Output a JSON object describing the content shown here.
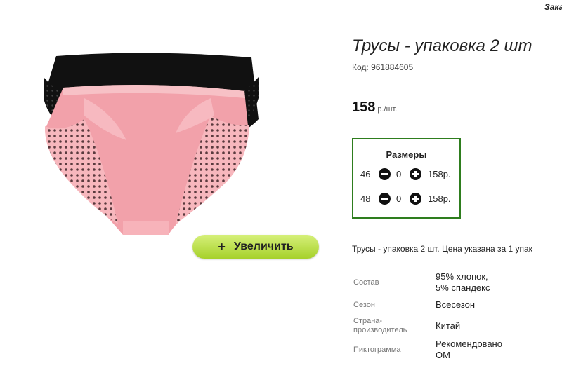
{
  "header": {
    "link_label": "Зака"
  },
  "product": {
    "title": "Трусы - упаковка 2 шт",
    "sku": "Код: 961884605",
    "price": "158",
    "price_unit": "р./шт.",
    "zoom_label": "Увеличить",
    "description": "Трусы - упаковка 2 шт. Цена указана за 1 упак"
  },
  "sizes": {
    "title": "Размеры",
    "rows": [
      {
        "size": "46",
        "qty": "0",
        "price": "158р."
      },
      {
        "size": "48",
        "qty": "0",
        "price": "158р."
      }
    ]
  },
  "specs": [
    {
      "label": "Состав",
      "value_lines": [
        "95% хлопок,",
        "5% спандекс"
      ]
    },
    {
      "label": "Сезон",
      "value_lines": [
        "Всесезон"
      ]
    },
    {
      "label_lines": [
        "Страна-",
        "производитель"
      ],
      "value_lines": [
        "Китай"
      ]
    },
    {
      "label": "Пиктограмма",
      "value_lines": [
        "Рекомендовано",
        "ОМ"
      ]
    }
  ],
  "colors": {
    "accent_green": "#2e7d1e",
    "button_green": "#b8e04a",
    "product_pink": "#f3a2aa",
    "product_black": "#111111"
  },
  "icons": {
    "minus": "minus-circle-icon",
    "plus": "plus-circle-icon"
  }
}
